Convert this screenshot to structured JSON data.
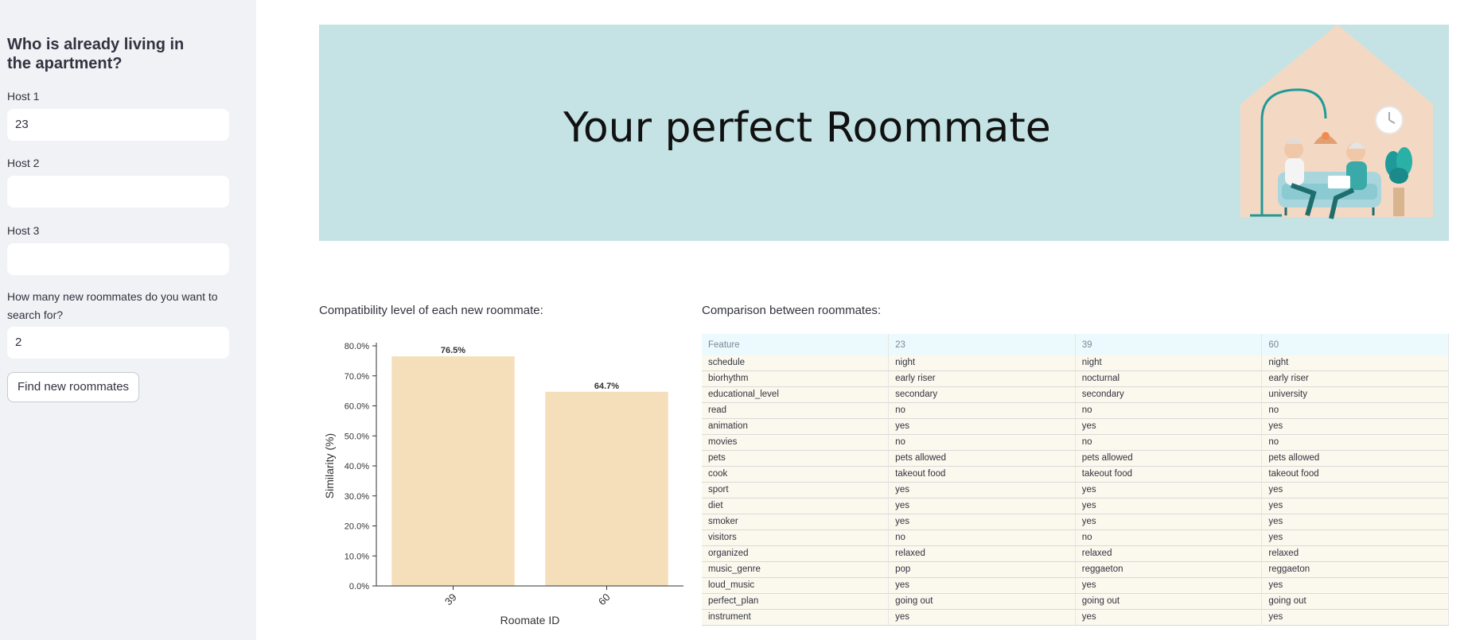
{
  "sidebar": {
    "heading": "Who is already living in the apartment?",
    "host1_label": "Host 1",
    "host1_value": "23",
    "host2_label": "Host 2",
    "host2_value": "",
    "host3_label": "Host 3",
    "host3_value": "",
    "count_label": "How many new roommates do you want to search for?",
    "count_value": "2",
    "find_button": "Find new roommates"
  },
  "banner": {
    "title": "Your perfect Roommate",
    "illustration_icon": "elderly-couple-home-icon"
  },
  "chart_caption": "Compatibility level of each new roommate:",
  "table_caption": "Comparison between roommates:",
  "chart_data": {
    "type": "bar",
    "categories": [
      "39",
      "60"
    ],
    "values": [
      76.5,
      64.7
    ],
    "value_labels": [
      "76.5%",
      "64.7%"
    ],
    "xlabel": "Roomate ID",
    "ylabel": "Similarity (%)",
    "ylim": [
      0,
      80
    ],
    "yticks": [
      "0.0%",
      "10.0%",
      "20.0%",
      "30.0%",
      "40.0%",
      "50.0%",
      "60.0%",
      "70.0%",
      "80.0%"
    ],
    "bar_color": "#f5dfbb",
    "grid": false
  },
  "table": {
    "columns": [
      "Feature",
      "23",
      "39",
      "60"
    ],
    "rows": [
      [
        "schedule",
        "night",
        "night",
        "night"
      ],
      [
        "biorhythm",
        "early riser",
        "nocturnal",
        "early riser"
      ],
      [
        "educational_level",
        "secondary",
        "secondary",
        "university"
      ],
      [
        "read",
        "no",
        "no",
        "no"
      ],
      [
        "animation",
        "yes",
        "yes",
        "yes"
      ],
      [
        "movies",
        "no",
        "no",
        "no"
      ],
      [
        "pets",
        "pets allowed",
        "pets allowed",
        "pets allowed"
      ],
      [
        "cook",
        "takeout food",
        "takeout food",
        "takeout food"
      ],
      [
        "sport",
        "yes",
        "yes",
        "yes"
      ],
      [
        "diet",
        "yes",
        "yes",
        "yes"
      ],
      [
        "smoker",
        "yes",
        "yes",
        "yes"
      ],
      [
        "visitors",
        "no",
        "no",
        "yes"
      ],
      [
        "organized",
        "relaxed",
        "relaxed",
        "relaxed"
      ],
      [
        "music_genre",
        "pop",
        "reggaeton",
        "reggaeton"
      ],
      [
        "loud_music",
        "yes",
        "yes",
        "yes"
      ],
      [
        "perfect_plan",
        "going out",
        "going out",
        "going out"
      ],
      [
        "instrument",
        "yes",
        "yes",
        "yes"
      ]
    ]
  },
  "colors": {
    "sidebar_bg": "#f0f2f6",
    "banner_bg": "#c5e3e5",
    "table_header_bg": "#ecfafd",
    "table_cell_bg": "#fbf8ee",
    "bar": "#f5dfbb"
  }
}
